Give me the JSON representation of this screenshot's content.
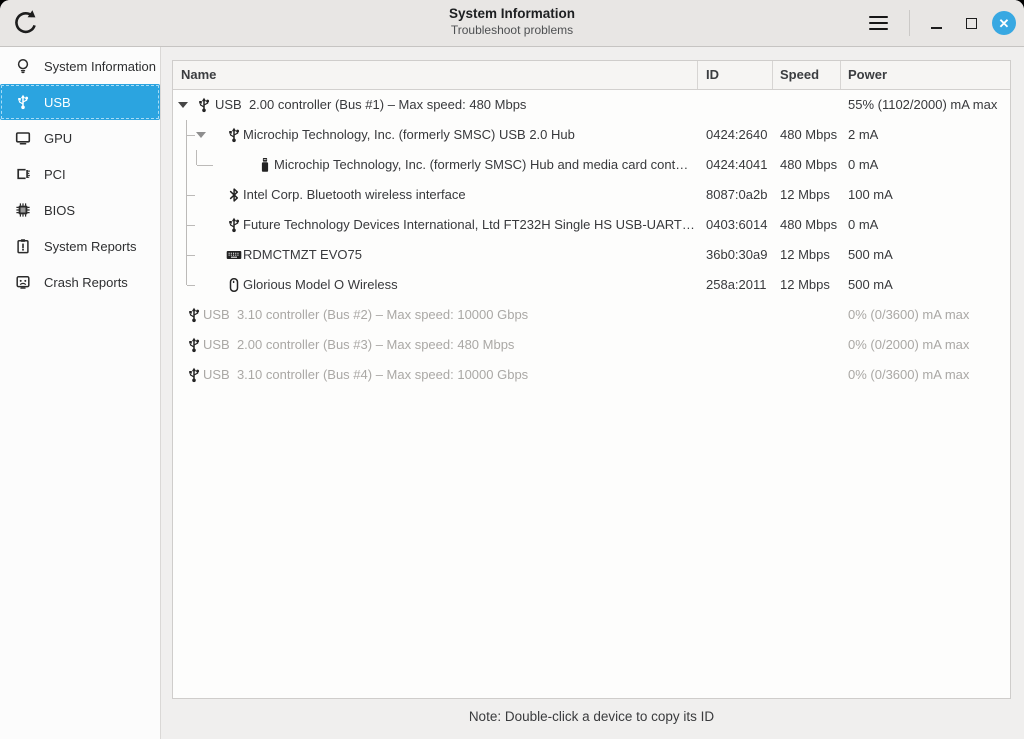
{
  "window": {
    "title": "System Information",
    "subtitle": "Troubleshoot problems",
    "controls": [
      {
        "name": "refresh",
        "icon": "refresh-icon"
      },
      {
        "name": "menu",
        "icon": "hamburger-icon"
      },
      {
        "name": "minimize",
        "icon": "minimize-icon"
      },
      {
        "name": "maximize",
        "icon": "maximize-icon"
      },
      {
        "name": "close",
        "icon": "close-x-icon"
      }
    ]
  },
  "colors": {
    "accent_blue": "#2ba4e0",
    "close_button_blue": "#38a8e2",
    "grayed_text": "#aaa8a5"
  },
  "sidebar": {
    "items": [
      {
        "label": "System Information",
        "icon": "lightbulb-icon",
        "selected": false
      },
      {
        "label": "USB",
        "icon": "usb-icon",
        "selected": true
      },
      {
        "label": "GPU",
        "icon": "monitor-icon",
        "selected": false
      },
      {
        "label": "PCI",
        "icon": "pci-card-icon",
        "selected": false
      },
      {
        "label": "BIOS",
        "icon": "chip-icon",
        "selected": false
      },
      {
        "label": "System Reports",
        "icon": "report-icon",
        "selected": false
      },
      {
        "label": "Crash Reports",
        "icon": "crash-face-icon",
        "selected": false
      }
    ]
  },
  "table": {
    "columns": [
      "Name",
      "ID",
      "Speed",
      "Power"
    ],
    "rows": [
      {
        "level": 0,
        "expander": "dark",
        "guides": [],
        "icon": "usb-icon",
        "name": "USB  2.00 controller (Bus #1) – Max speed: 480 Mbps",
        "id": "",
        "speed": "",
        "power": "55% (1102/2000) mA max",
        "grayed": false
      },
      {
        "level": 1,
        "expander": "shade",
        "guides": [
          "tee"
        ],
        "icon": "usb-icon",
        "name": "Microchip Technology, Inc. (formerly SMSC) USB 2.0 Hub",
        "id": "0424:2640",
        "speed": "480 Mbps",
        "power": "2 mA",
        "grayed": false
      },
      {
        "level": 2,
        "expander": "",
        "guides": [
          "pass",
          "elbow2"
        ],
        "icon": "usb-stick-icon",
        "name": "Microchip Technology, Inc. (formerly SMSC) Hub and media card cont…",
        "id": "0424:4041",
        "speed": "480 Mbps",
        "power": "0 mA",
        "grayed": false
      },
      {
        "level": 1,
        "expander": "",
        "guides": [
          "tee"
        ],
        "icon": "bluetooth-icon",
        "name": "Intel Corp. Bluetooth wireless interface",
        "id": "8087:0a2b",
        "speed": "12 Mbps",
        "power": "100 mA",
        "grayed": false
      },
      {
        "level": 1,
        "expander": "",
        "guides": [
          "tee"
        ],
        "icon": "usb-icon",
        "name": "Future Technology Devices International, Ltd FT232H Single HS USB-UART…",
        "id": "0403:6014",
        "speed": "480 Mbps",
        "power": "0 mA",
        "grayed": false
      },
      {
        "level": 1,
        "expander": "",
        "guides": [
          "tee"
        ],
        "icon": "keyboard-icon",
        "name": "RDMCTMZT EVO75",
        "id": "36b0:30a9",
        "speed": "12 Mbps",
        "power": "500 mA",
        "grayed": false
      },
      {
        "level": 1,
        "expander": "",
        "guides": [
          "elbow"
        ],
        "icon": "mouse-icon",
        "name": "Glorious Model O Wireless",
        "id": "258a:2011",
        "speed": "12 Mbps",
        "power": "500 mA",
        "grayed": false
      },
      {
        "level": 0,
        "expander": "",
        "guides": [],
        "icon": "usb-icon",
        "name": "USB  3.10 controller (Bus #2) – Max speed: 10000 Gbps",
        "id": "",
        "speed": "",
        "power": "0% (0/3600) mA max",
        "grayed": true
      },
      {
        "level": 0,
        "expander": "",
        "guides": [],
        "icon": "usb-icon",
        "name": "USB  2.00 controller (Bus #3) – Max speed: 480 Mbps",
        "id": "",
        "speed": "",
        "power": "0% (0/2000) mA max",
        "grayed": true
      },
      {
        "level": 0,
        "expander": "",
        "guides": [],
        "icon": "usb-icon",
        "name": "USB  3.10 controller (Bus #4) – Max speed: 10000 Gbps",
        "id": "",
        "speed": "",
        "power": "0% (0/3600) mA max",
        "grayed": true
      }
    ],
    "note": "Note: Double-click a device to copy its ID"
  }
}
